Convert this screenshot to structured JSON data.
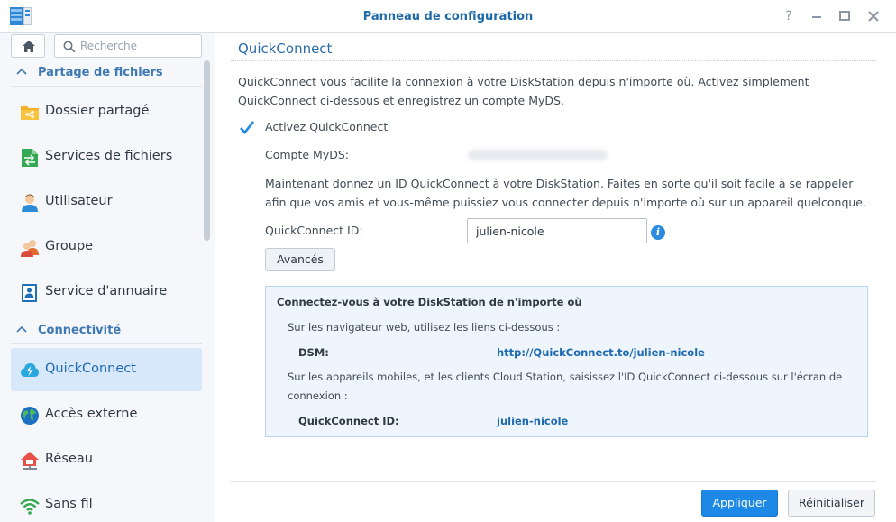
{
  "window": {
    "title": "Panneau de configuration",
    "controls": [
      "help-icon",
      "minimize-icon",
      "maximize-icon",
      "close-icon"
    ]
  },
  "sidebar": {
    "search_placeholder": "Recherche",
    "sections": [
      {
        "label": "Partage de fichiers",
        "items": [
          {
            "label": "Dossier partagé",
            "icon": "shared-folder-icon"
          },
          {
            "label": "Services de fichiers",
            "icon": "file-services-icon"
          },
          {
            "label": "Utilisateur",
            "icon": "user-icon"
          },
          {
            "label": "Groupe",
            "icon": "group-icon"
          },
          {
            "label": "Service d'annuaire",
            "icon": "directory-service-icon"
          }
        ]
      },
      {
        "label": "Connectivité",
        "items": [
          {
            "label": "QuickConnect",
            "icon": "quickconnect-icon",
            "active": true
          },
          {
            "label": "Accès externe",
            "icon": "external-access-icon"
          },
          {
            "label": "Réseau",
            "icon": "network-icon"
          },
          {
            "label": "Sans fil",
            "icon": "wireless-icon"
          }
        ]
      }
    ]
  },
  "main": {
    "title": "QuickConnect",
    "description": "QuickConnect vous facilite la connexion à votre DiskStation depuis n'importe où. Activez simplement QuickConnect ci-dessous et enregistrez un compte MyDS.",
    "enable_label": "Activez QuickConnect",
    "enable_checked": true,
    "account_label": "Compte MyDS:",
    "instruction": "Maintenant donnez un ID QuickConnect à votre DiskStation. Faites en sorte qu'il soit facile à se rappeler afin que vos amis et vous-même puissiez vous connecter depuis n'importe où sur un appareil quelconque.",
    "qcid_label": "QuickConnect ID:",
    "qcid_value": "julien-nicole",
    "advanced_button": "Avancés",
    "info_box": {
      "title": "Connectez-vous à votre DiskStation de n'importe où",
      "web_text": "Sur les navigateur web, utilisez les liens ci-dessous :",
      "dsm_label": "DSM:",
      "dsm_link": "http://QuickConnect.to/julien-nicole",
      "mobile_text": "Sur les appareils mobiles, et les clients Cloud Station, saisissez l'ID QuickConnect ci-dessous sur l'écran de connexion :",
      "id_label": "QuickConnect ID:",
      "id_value": "julien-nicole"
    },
    "apply_button": "Appliquer",
    "reset_button": "Réinitialiser"
  },
  "colors": {
    "accent": "#1d88e5",
    "title": "#1f6aa8",
    "sidebar_bg": "#f5f7fa",
    "active_item_bg": "#d6e8f9",
    "info_box_bg": "#eef5fc"
  }
}
